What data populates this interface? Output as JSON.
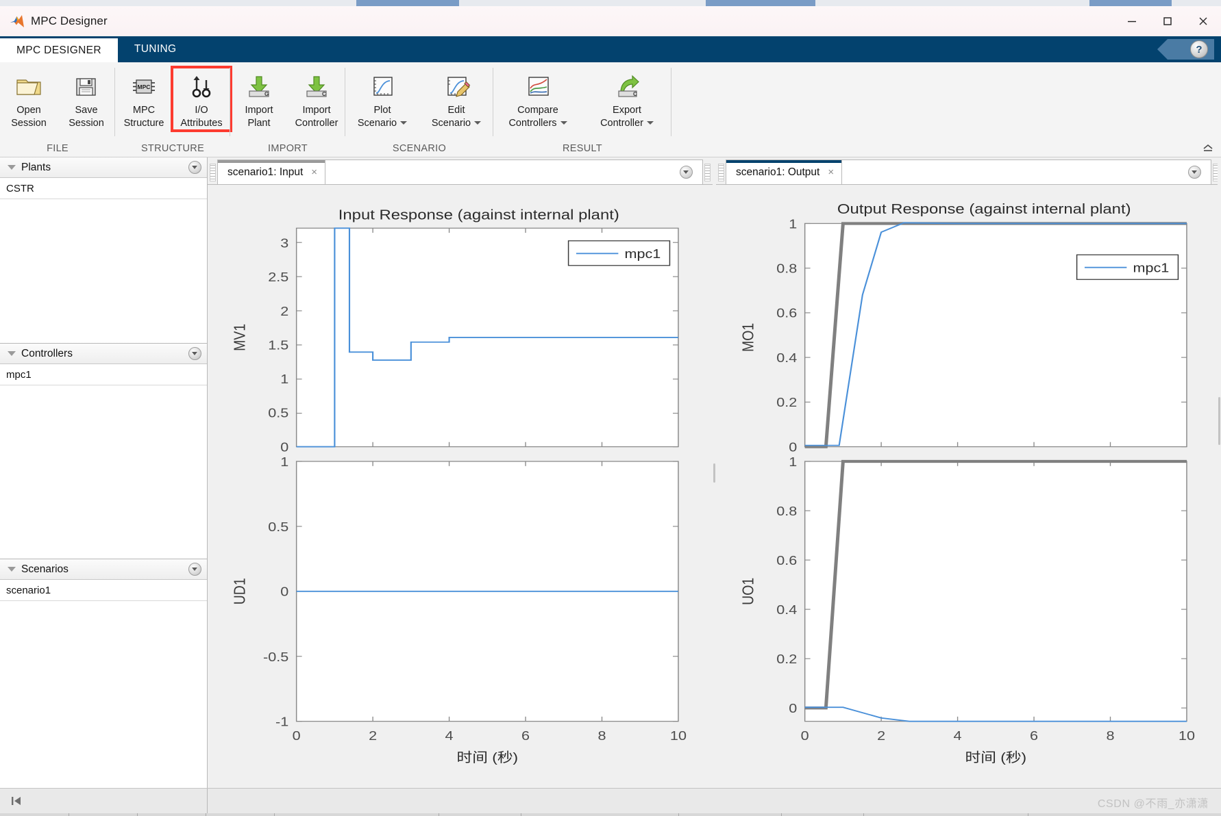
{
  "window": {
    "title": "MPC Designer",
    "app_icon": "matlab-logo",
    "minimize": "–",
    "maximize": "□",
    "close": "✕"
  },
  "ribbon_tabs": [
    {
      "label": "MPC DESIGNER",
      "active": true
    },
    {
      "label": "TUNING",
      "active": false
    }
  ],
  "help": {
    "glyph": "?"
  },
  "ribbon": {
    "collapse_glyph": "⌃",
    "groups": [
      {
        "label": "FILE",
        "buttons": [
          {
            "name": "open-session",
            "line1": "Open",
            "line2": "Session",
            "icon": "folder-icon",
            "dropdown": false,
            "highlight": false
          },
          {
            "name": "save-session",
            "line1": "Save",
            "line2": "Session",
            "icon": "floppy-disk-icon",
            "dropdown": false,
            "highlight": false
          }
        ]
      },
      {
        "label": "STRUCTURE",
        "buttons": [
          {
            "name": "mpc-structure",
            "line1": "MPC",
            "line2": "Structure",
            "icon": "mpc-chip-icon",
            "dropdown": false,
            "highlight": false
          },
          {
            "name": "io-attributes",
            "line1": "I/O",
            "line2": "Attributes",
            "icon": "io-arrows-icon",
            "dropdown": false,
            "highlight": true
          }
        ]
      },
      {
        "label": "IMPORT",
        "buttons": [
          {
            "name": "import-plant",
            "line1": "Import",
            "line2": "Plant",
            "icon": "import-green-arrow-icon",
            "dropdown": false,
            "highlight": false
          },
          {
            "name": "import-controller",
            "line1": "Import",
            "line2": "Controller",
            "icon": "import-green-arrow-c-icon",
            "dropdown": false,
            "highlight": false
          }
        ]
      },
      {
        "label": "SCENARIO",
        "buttons": [
          {
            "name": "plot-scenario",
            "line1": "Plot",
            "line2": "Scenario",
            "icon": "plot-curve-icon",
            "dropdown": true,
            "highlight": false
          },
          {
            "name": "edit-scenario",
            "line1": "Edit",
            "line2": "Scenario",
            "icon": "plot-curve-pencil-icon",
            "dropdown": true,
            "highlight": false
          }
        ]
      },
      {
        "label": "RESULT",
        "buttons": [
          {
            "name": "compare-controllers",
            "line1": "Compare",
            "line2": "Controllers",
            "icon": "multi-curve-icon",
            "dropdown": true,
            "highlight": false
          },
          {
            "name": "export-controller",
            "line1": "Export",
            "line2": "Controller",
            "icon": "export-green-arrow-c-icon",
            "dropdown": true,
            "highlight": false
          }
        ]
      }
    ]
  },
  "data_browser": {
    "sections": [
      {
        "name": "plants",
        "title": "Plants",
        "items": [
          "CSTR"
        ]
      },
      {
        "name": "controllers",
        "title": "Controllers",
        "items": [
          "mpc1"
        ]
      },
      {
        "name": "scenarios",
        "title": "Scenarios",
        "items": [
          "scenario1"
        ]
      }
    ]
  },
  "documents": [
    {
      "name": "input",
      "tab_label": "scenario1: Input",
      "active": false,
      "close_glyph": "×"
    },
    {
      "name": "output",
      "tab_label": "scenario1: Output",
      "active": true,
      "close_glyph": "×"
    }
  ],
  "status_bar": {
    "prev_glyph": "⏮",
    "watermark": "CSDN @不雨_亦潇潇"
  },
  "colors": {
    "accent": "#03426e",
    "highlight": "#fd3b30",
    "series_blue": "#4a90d9",
    "reference_gray": "#7f7f7f",
    "ribbon_bg": "#f4f4f4",
    "figure_bg": "#f0f0f0"
  },
  "chart_data": [
    {
      "type": "line",
      "name": "input-mv1",
      "title": "Input Response (against internal plant)",
      "xlabel": "时间 (秒)",
      "ylabel": "MV1",
      "xlim": [
        0,
        10
      ],
      "ylim": [
        0,
        3.2
      ],
      "xticks": [
        0,
        2,
        4,
        6,
        8,
        10
      ],
      "yticks": [
        0,
        0.5,
        1,
        1.5,
        2,
        2.5,
        3
      ],
      "ytick_labels": [
        "0",
        "0.5",
        "1",
        "1.5",
        "2",
        "2.5",
        "3"
      ],
      "grid": false,
      "legend": {
        "entries": [
          "mpc1"
        ],
        "position": "top-right"
      },
      "series": [
        {
          "name": "mpc1",
          "color": "#4a90d9",
          "style": "stairs",
          "x": [
            0,
            1,
            1,
            1.5,
            1.5,
            2,
            2,
            2.5,
            2.5,
            3,
            3,
            3.5,
            3.5,
            10
          ],
          "y": [
            0,
            0,
            3.2,
            3.2,
            1.38,
            1.38,
            1.27,
            1.27,
            1.54,
            1.54,
            1.61,
            1.61,
            1.61,
            1.61
          ]
        }
      ]
    },
    {
      "type": "line",
      "name": "input-ud1",
      "title": "",
      "xlabel": "时间 (秒)",
      "ylabel": "UD1",
      "xlim": [
        0,
        10
      ],
      "ylim": [
        -1,
        1
      ],
      "xticks": [
        0,
        2,
        4,
        6,
        8,
        10
      ],
      "yticks": [
        -1,
        -0.5,
        0,
        0.5,
        1
      ],
      "ytick_labels": [
        "-1",
        "-0.5",
        "0",
        "0.5",
        "1"
      ],
      "grid": false,
      "legend": null,
      "series": [
        {
          "name": "mpc1",
          "color": "#4a90d9",
          "style": "line",
          "x": [
            0,
            10
          ],
          "y": [
            0,
            0
          ]
        }
      ]
    },
    {
      "type": "line",
      "name": "output-mo1",
      "title": "Output Response (against internal plant)",
      "xlabel": "时间 (秒)",
      "ylabel": "MO1",
      "xlim": [
        0,
        10
      ],
      "ylim": [
        0,
        1
      ],
      "xticks": [
        0,
        2,
        4,
        6,
        8,
        10
      ],
      "yticks": [
        0,
        0.2,
        0.4,
        0.6,
        0.8,
        1
      ],
      "ytick_labels": [
        "0",
        "0.2",
        "0.4",
        "0.6",
        "0.8",
        "1"
      ],
      "grid": false,
      "legend": {
        "entries": [
          "mpc1"
        ],
        "position": "top-right"
      },
      "series": [
        {
          "name": "reference",
          "color": "#7f7f7f",
          "style": "line",
          "x": [
            0,
            0.55,
            1.0,
            10
          ],
          "y": [
            0,
            0,
            1,
            1
          ]
        },
        {
          "name": "mpc1",
          "color": "#4a90d9",
          "style": "line",
          "x": [
            0,
            0.9,
            1.5,
            2.0,
            2.6,
            4,
            10
          ],
          "y": [
            0,
            0,
            0.68,
            0.965,
            1.0,
            1.0,
            1.0
          ]
        }
      ]
    },
    {
      "type": "line",
      "name": "output-uo1",
      "title": "",
      "xlabel": "时间 (秒)",
      "ylabel": "UO1",
      "xlim": [
        0,
        10
      ],
      "ylim": [
        -0.06,
        1
      ],
      "xticks": [
        0,
        2,
        4,
        6,
        8,
        10
      ],
      "yticks": [
        0,
        0.2,
        0.4,
        0.6,
        0.8,
        1
      ],
      "ytick_labels": [
        "0",
        "0.2",
        "0.4",
        "0.6",
        "0.8",
        "1"
      ],
      "grid": false,
      "legend": null,
      "series": [
        {
          "name": "reference",
          "color": "#7f7f7f",
          "style": "line",
          "x": [
            0,
            0.55,
            1.0,
            10
          ],
          "y": [
            0,
            0,
            1,
            1
          ]
        },
        {
          "name": "mpc1",
          "color": "#4a90d9",
          "style": "line",
          "x": [
            0,
            1.0,
            2.0,
            2.7,
            10
          ],
          "y": [
            0,
            0,
            -0.045,
            -0.058,
            -0.058
          ]
        }
      ]
    }
  ]
}
